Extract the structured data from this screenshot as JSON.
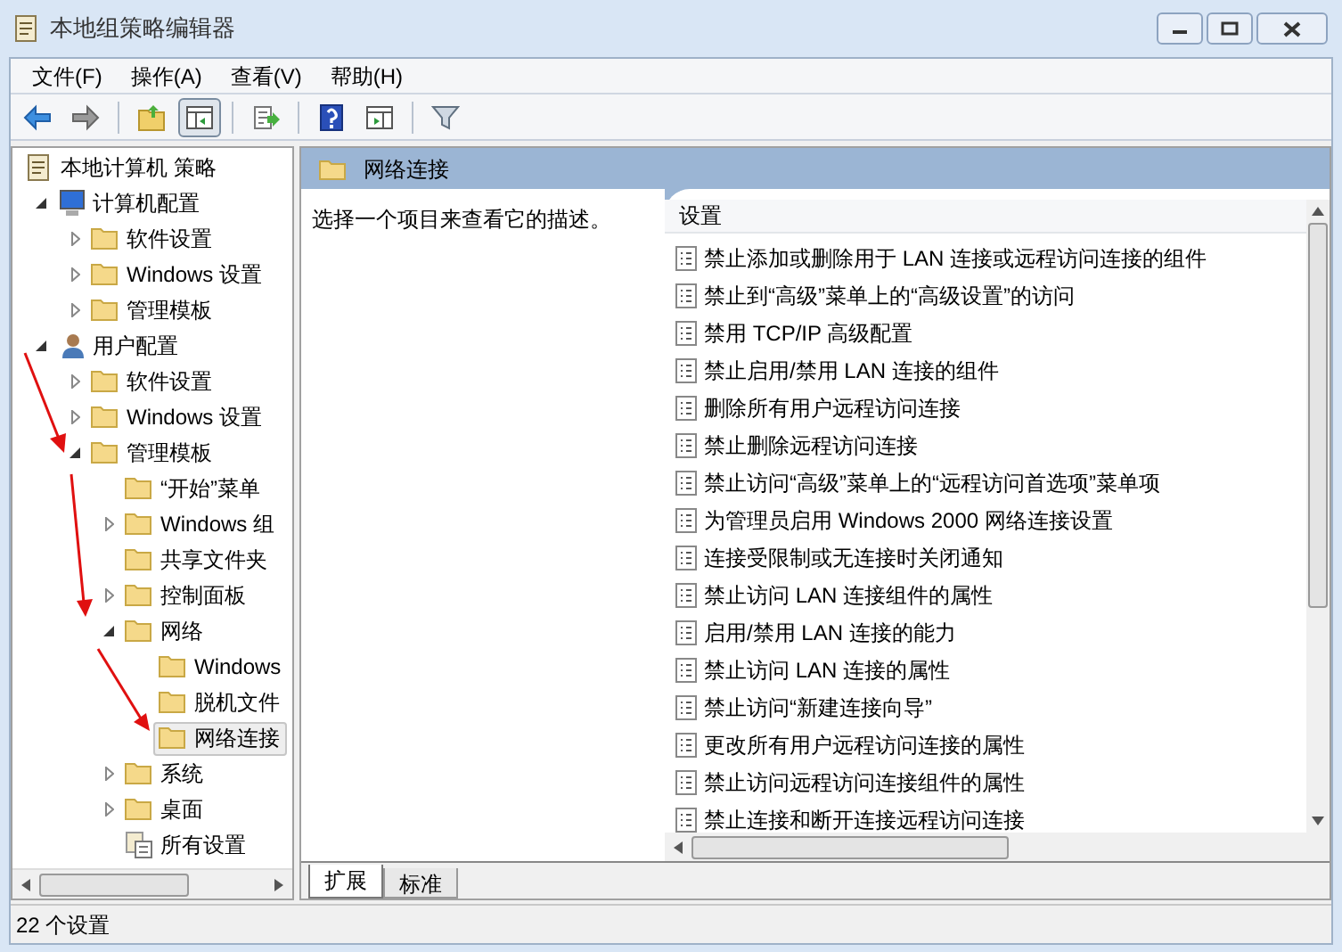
{
  "window": {
    "title": "本地组策略编辑器"
  },
  "menu": [
    "文件(F)",
    "操作(A)",
    "查看(V)",
    "帮助(H)"
  ],
  "toolbar": [
    {
      "kind": "back",
      "pressed": false
    },
    {
      "kind": "forward",
      "pressed": false
    },
    {
      "kind": "separator"
    },
    {
      "kind": "up",
      "pressed": false
    },
    {
      "kind": "tree",
      "pressed": true
    },
    {
      "kind": "separator"
    },
    {
      "kind": "export",
      "pressed": false
    },
    {
      "kind": "separator"
    },
    {
      "kind": "help",
      "pressed": false
    },
    {
      "kind": "pane",
      "pressed": false
    },
    {
      "kind": "separator"
    },
    {
      "kind": "filter",
      "pressed": false
    }
  ],
  "tree": [
    {
      "label": "本地计算机 策略",
      "kind": "policy",
      "selected": false,
      "children": [
        {
          "label": "计算机配置",
          "kind": "computer",
          "expanded": true,
          "selected": false,
          "children": [
            {
              "label": "软件设置",
              "kind": "folder",
              "expanded": false,
              "selected": false
            },
            {
              "label": "Windows 设置",
              "kind": "folder",
              "expanded": false,
              "selected": false
            },
            {
              "label": "管理模板",
              "kind": "folder",
              "expanded": false,
              "selected": false
            }
          ]
        },
        {
          "label": "用户配置",
          "kind": "user",
          "expanded": true,
          "selected": false,
          "children": [
            {
              "label": "软件设置",
              "kind": "folder",
              "expanded": false,
              "selected": false
            },
            {
              "label": "Windows 设置",
              "kind": "folder",
              "expanded": false,
              "selected": false
            },
            {
              "label": "管理模板",
              "kind": "folder",
              "expanded": true,
              "selected": false,
              "children": [
                {
                  "label": "“开始”菜单",
                  "kind": "folder",
                  "selected": false
                },
                {
                  "label": "Windows 组",
                  "kind": "folder",
                  "expanded": false,
                  "selected": false
                },
                {
                  "label": "共享文件夹",
                  "kind": "folder",
                  "selected": false
                },
                {
                  "label": "控制面板",
                  "kind": "folder",
                  "expanded": false,
                  "selected": false
                },
                {
                  "label": "网络",
                  "kind": "folder",
                  "expanded": true,
                  "selected": false,
                  "children": [
                    {
                      "label": "Windows",
                      "kind": "folder",
                      "selected": false
                    },
                    {
                      "label": "脱机文件",
                      "kind": "folder",
                      "selected": false
                    },
                    {
                      "label": "网络连接",
                      "kind": "folder",
                      "selected": true
                    }
                  ]
                },
                {
                  "label": "系统",
                  "kind": "folder",
                  "expanded": false,
                  "selected": false
                },
                {
                  "label": "桌面",
                  "kind": "folder",
                  "expanded": false,
                  "selected": false
                },
                {
                  "label": "所有设置",
                  "kind": "settings",
                  "selected": false
                }
              ]
            }
          ]
        }
      ]
    }
  ],
  "details": {
    "header": "网络连接",
    "description": "选择一个项目来查看它的描述。",
    "column": "设置",
    "rows": [
      "禁止添加或删除用于 LAN 连接或远程访问连接的组件",
      "禁止到“高级”菜单上的“高级设置”的访问",
      "禁用 TCP/IP 高级配置",
      "禁止启用/禁用 LAN 连接的组件",
      "删除所有用户远程访问连接",
      "禁止删除远程访问连接",
      "禁止访问“高级”菜单上的“远程访问首选项”菜单项",
      "为管理员启用 Windows 2000 网络连接设置",
      "连接受限制或无连接时关闭通知",
      "禁止访问 LAN 连接组件的属性",
      "启用/禁用 LAN 连接的能力",
      "禁止访问 LAN 连接的属性",
      "禁止访问“新建连接向导”",
      "更改所有用户远程访问连接的属性",
      "禁止访问远程访问连接组件的属性",
      "禁止连接和断开连接远程访问连接"
    ],
    "tabs": [
      {
        "label": "扩展",
        "selected": true
      },
      {
        "label": "标准",
        "selected": false
      }
    ]
  },
  "status_bar": "22 个设置"
}
